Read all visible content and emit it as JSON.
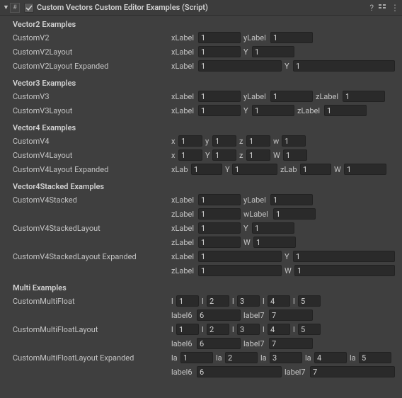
{
  "header": {
    "title": "Custom Vectors Custom Editor Examples (Script)",
    "enabled": true
  },
  "sections": [
    {
      "title": "Vector2 Examples",
      "rows": [
        {
          "label": "CustomV2",
          "fields": [
            {
              "label": "xLabel",
              "value": "1",
              "lw": 36,
              "iw": 60
            },
            {
              "label": "yLabel",
              "value": "1",
              "lw": 36,
              "iw": 60
            }
          ]
        },
        {
          "label": "CustomV2Layout",
          "fields": [
            {
              "label": "xLabel",
              "value": "1",
              "lw": 36,
              "iw": 60
            },
            {
              "label": "Y",
              "value": "1",
              "lw": 10,
              "iw": 60
            }
          ]
        },
        {
          "label": "CustomV2Layout Expanded",
          "fields": [
            {
              "label": "xLabel",
              "value": "1",
              "lw": 36,
              "iw": 118
            },
            {
              "label": "Y",
              "value": "1",
              "lw": 10,
              "iw": 144
            }
          ]
        }
      ]
    },
    {
      "title": "Vector3 Examples",
      "rows": [
        {
          "label": "CustomV3",
          "fields": [
            {
              "label": "xLabel",
              "value": "1",
              "lw": 36,
              "iw": 60
            },
            {
              "label": "yLabel",
              "value": "1",
              "lw": 36,
              "iw": 60
            },
            {
              "label": "zLabel",
              "value": "1",
              "lw": 36,
              "iw": 60
            }
          ]
        },
        {
          "label": "CustomV3Layout",
          "fields": [
            {
              "label": "xLabel",
              "value": "1",
              "lw": 36,
              "iw": 60
            },
            {
              "label": "Y",
              "value": "1",
              "lw": 10,
              "iw": 60
            },
            {
              "label": "zLabel",
              "value": "1",
              "lw": 36,
              "iw": 60
            }
          ]
        }
      ]
    },
    {
      "title": "Vector4 Examples",
      "rows": [
        {
          "label": "CustomV4",
          "fields": [
            {
              "label": "x",
              "value": "1",
              "lw": 8,
              "iw": 34
            },
            {
              "label": "y",
              "value": "1",
              "lw": 8,
              "iw": 34
            },
            {
              "label": "z",
              "value": "1",
              "lw": 8,
              "iw": 34
            },
            {
              "label": "w",
              "value": "1",
              "lw": 10,
              "iw": 34
            }
          ]
        },
        {
          "label": "CustomV4Layout",
          "fields": [
            {
              "label": "x",
              "value": "1",
              "lw": 8,
              "iw": 34
            },
            {
              "label": "Y",
              "value": "1",
              "lw": 8,
              "iw": 34
            },
            {
              "label": "z",
              "value": "1",
              "lw": 8,
              "iw": 34
            },
            {
              "label": "W",
              "value": "1",
              "lw": 12,
              "iw": 34
            }
          ]
        },
        {
          "label": "CustomV4Layout Expanded",
          "fields": [
            {
              "label": "xLab",
              "value": "1",
              "lw": 26,
              "iw": 44
            },
            {
              "label": "Y",
              "value": "1",
              "lw": 8,
              "iw": 64
            },
            {
              "label": "zLab",
              "value": "1",
              "lw": 26,
              "iw": 44
            },
            {
              "label": "W",
              "value": "1",
              "lw": 12,
              "iw": 60
            }
          ]
        }
      ]
    },
    {
      "title": "Vector4Stacked Examples",
      "rows": [
        {
          "label": "CustomV4Stacked",
          "fields": [
            {
              "label": "xLabel",
              "value": "1",
              "lw": 36,
              "iw": 60
            },
            {
              "label": "yLabel",
              "value": "1",
              "lw": 36,
              "iw": 60
            }
          ]
        },
        {
          "label": "",
          "fields": [
            {
              "label": "zLabel",
              "value": "1",
              "lw": 36,
              "iw": 60
            },
            {
              "label": "wLabel",
              "value": "1",
              "lw": 40,
              "iw": 60
            }
          ]
        },
        {
          "label": "CustomV4StackedLayout",
          "fields": [
            {
              "label": "xLabel",
              "value": "1",
              "lw": 36,
              "iw": 60
            },
            {
              "label": "Y",
              "value": "1",
              "lw": 10,
              "iw": 60
            }
          ]
        },
        {
          "label": "",
          "fields": [
            {
              "label": "zLabel",
              "value": "1",
              "lw": 36,
              "iw": 60
            },
            {
              "label": "W",
              "value": "1",
              "lw": 12,
              "iw": 60
            }
          ]
        },
        {
          "label": "CustomV4StackedLayout Expanded",
          "fields": [
            {
              "label": "xLabel",
              "value": "1",
              "lw": 36,
              "iw": 118
            },
            {
              "label": "Y",
              "value": "1",
              "lw": 10,
              "iw": 144
            }
          ]
        },
        {
          "label": "",
          "fields": [
            {
              "label": "zLabel",
              "value": "1",
              "lw": 36,
              "iw": 118
            },
            {
              "label": "W",
              "value": "1",
              "lw": 12,
              "iw": 142
            }
          ]
        }
      ]
    },
    {
      "title": "Multi Examples",
      "rows": [
        {
          "label": "CustomMultiFloat",
          "fields": [
            {
              "label": "l",
              "value": "1",
              "lw": 5,
              "iw": 32
            },
            {
              "label": "l",
              "value": "2",
              "lw": 5,
              "iw": 32
            },
            {
              "label": "l",
              "value": "3",
              "lw": 5,
              "iw": 32
            },
            {
              "label": "l",
              "value": "4",
              "lw": 5,
              "iw": 32
            },
            {
              "label": "l",
              "value": "5",
              "lw": 5,
              "iw": 32
            }
          ]
        },
        {
          "label": "",
          "fields": [
            {
              "label": "label6",
              "value": "6",
              "lw": 34,
              "iw": 62
            },
            {
              "label": "label7",
              "value": "7",
              "lw": 34,
              "iw": 62
            }
          ]
        },
        {
          "label": "CustomMultiFloatLayout",
          "fields": [
            {
              "label": "l",
              "value": "1",
              "lw": 5,
              "iw": 32
            },
            {
              "label": "l",
              "value": "2",
              "lw": 5,
              "iw": 32
            },
            {
              "label": "l",
              "value": "3",
              "lw": 5,
              "iw": 32
            },
            {
              "label": "l",
              "value": "4",
              "lw": 5,
              "iw": 32
            },
            {
              "label": "l",
              "value": "5",
              "lw": 5,
              "iw": 32
            }
          ]
        },
        {
          "label": "",
          "fields": [
            {
              "label": "label6",
              "value": "6",
              "lw": 34,
              "iw": 62
            },
            {
              "label": "label7",
              "value": "7",
              "lw": 34,
              "iw": 62
            }
          ]
        },
        {
          "label": "CustomMultiFloatLayout Expanded",
          "fields": [
            {
              "label": "la",
              "value": "1",
              "lw": 11,
              "iw": 46
            },
            {
              "label": "la",
              "value": "2",
              "lw": 11,
              "iw": 46
            },
            {
              "label": "la",
              "value": "3",
              "lw": 11,
              "iw": 46
            },
            {
              "label": "la",
              "value": "4",
              "lw": 11,
              "iw": 46
            },
            {
              "label": "la",
              "value": "5",
              "lw": 11,
              "iw": 46
            }
          ]
        },
        {
          "label": "",
          "fields": [
            {
              "label": "label6",
              "value": "6",
              "lw": 34,
              "iw": 120
            },
            {
              "label": "label7",
              "value": "7",
              "lw": 34,
              "iw": 120
            }
          ]
        }
      ]
    }
  ]
}
